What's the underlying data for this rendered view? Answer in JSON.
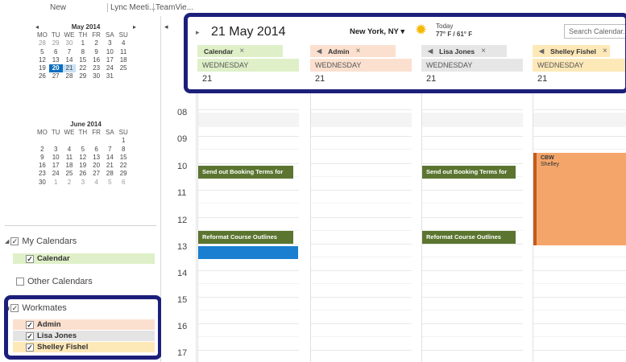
{
  "ribbon": {
    "items": [
      "New",
      "Lync Meeti...",
      "TeamVie..."
    ]
  },
  "mini_calendars": [
    {
      "month": "May 2014",
      "dow": [
        "MO",
        "TU",
        "WE",
        "TH",
        "FR",
        "SA",
        "SU"
      ],
      "weeks": [
        [
          "28",
          "29",
          "30",
          "1",
          "2",
          "3",
          "4"
        ],
        [
          "5",
          "6",
          "7",
          "8",
          "9",
          "10",
          "11"
        ],
        [
          "12",
          "13",
          "14",
          "15",
          "16",
          "17",
          "18"
        ],
        [
          "19",
          "20",
          "21",
          "22",
          "23",
          "24",
          "25"
        ],
        [
          "26",
          "27",
          "28",
          "29",
          "30",
          "31",
          ""
        ]
      ],
      "today": "20",
      "selected": "21"
    },
    {
      "month": "June 2014",
      "dow": [
        "MO",
        "TU",
        "WE",
        "TH",
        "FR",
        "SA",
        "SU"
      ],
      "weeks": [
        [
          "",
          "",
          "",
          "",
          "",
          "",
          "1"
        ],
        [
          "2",
          "3",
          "4",
          "5",
          "6",
          "7",
          "8"
        ],
        [
          "9",
          "10",
          "11",
          "12",
          "13",
          "14",
          "15"
        ],
        [
          "16",
          "17",
          "18",
          "19",
          "20",
          "21",
          "22"
        ],
        [
          "23",
          "24",
          "25",
          "26",
          "27",
          "28",
          "29"
        ],
        [
          "30",
          "1",
          "2",
          "3",
          "4",
          "5",
          "6"
        ]
      ]
    }
  ],
  "nav_glyphs": {
    "prev": "◂",
    "next": "▸"
  },
  "groups": {
    "my_calendars": {
      "label": "My Calendars",
      "items": [
        {
          "label": "Calendar",
          "color": "#dff0c8"
        }
      ]
    },
    "other_calendars": {
      "label": "Other Calendars"
    },
    "workmates": {
      "label": "Workmates",
      "items": [
        {
          "label": "Admin",
          "color": "#fbe0cf"
        },
        {
          "label": "Lisa Jones",
          "color": "#e4e4e4"
        },
        {
          "label": "Shelley Fishel",
          "color": "#fde8b8"
        }
      ]
    }
  },
  "header": {
    "date": "21 May 2014",
    "location": "New York, NY",
    "location_caret": "▾",
    "weather_today": "Today",
    "weather_temp": "77° F / 61° F",
    "search_placeholder": "Search Calendar..."
  },
  "columns": [
    {
      "tab": "Calendar",
      "dayname": "WEDNESDAY",
      "daynum": "21",
      "color": "#dff0c8",
      "has_arrow": false
    },
    {
      "tab": "Admin",
      "dayname": "WEDNESDAY",
      "daynum": "21",
      "color": "#fbe0cf",
      "has_arrow": true
    },
    {
      "tab": "Lisa Jones",
      "dayname": "WEDNESDAY",
      "daynum": "21",
      "color": "#e6e6e6",
      "has_arrow": true
    },
    {
      "tab": "Shelley Fishel",
      "dayname": "WEDNESDAY",
      "daynum": "21",
      "color": "#fde8b8",
      "has_arrow": true
    }
  ],
  "hours": [
    "08",
    "09",
    "10",
    "11",
    "12",
    "13",
    "14",
    "15",
    "16",
    "17"
  ],
  "events": {
    "booking_terms": "Send out Booking Terms for",
    "course_outlines": "Reformat Course Outlines",
    "cbw_title": "CBW",
    "cbw_owner": "Shelley"
  },
  "colors": {
    "accent_blue": "#0b6ebf",
    "highlight_border": "#1c1f7a",
    "event_green": "#5b7530",
    "event_blue": "#1a7fd0",
    "event_orange": "#f4a66a"
  }
}
